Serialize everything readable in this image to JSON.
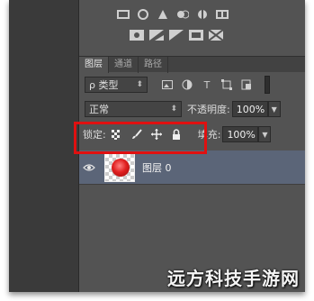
{
  "tabs": [
    {
      "label": "图层",
      "active": true
    },
    {
      "label": "通道",
      "active": false
    },
    {
      "label": "路径",
      "active": false
    }
  ],
  "filter": {
    "kind_label": "ρ 类型",
    "icons": [
      "image-filter-icon",
      "adjustment-filter-icon",
      "type-filter-icon",
      "shape-filter-icon",
      "smart-object-filter-icon"
    ]
  },
  "blend": {
    "mode": "正常",
    "opacity_label": "不透明度:",
    "opacity_value": "100%"
  },
  "lock": {
    "label": "锁定:",
    "fill_label": "填充:",
    "fill_value": "100%"
  },
  "layers": [
    {
      "name": "图层 0",
      "visible": true
    }
  ],
  "watermark": "远方科技手游网",
  "colors": {
    "panel": "#535353",
    "selected_layer": "#5b6578",
    "highlight": "#e01010"
  }
}
